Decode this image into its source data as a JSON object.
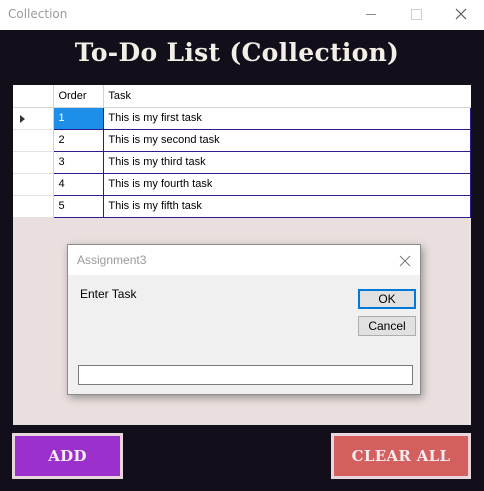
{
  "window": {
    "title": "Collection"
  },
  "app": {
    "heading": "To-Do List (Collection)"
  },
  "grid": {
    "columns": [
      "Order",
      "Task"
    ],
    "rows": [
      {
        "order": "1",
        "task": "This is my first task"
      },
      {
        "order": "2",
        "task": "This is my second task"
      },
      {
        "order": "3",
        "task": "This is my third task"
      },
      {
        "order": "4",
        "task": "This is my fourth task"
      },
      {
        "order": "5",
        "task": "This is my fifth task"
      }
    ],
    "selected_row": 0
  },
  "dialog": {
    "title": "Assignment3",
    "prompt": "Enter Task",
    "ok_label": "OK",
    "cancel_label": "Cancel",
    "input_value": ""
  },
  "buttons": {
    "add_label": "ADD",
    "clear_label": "CLEAR ALL"
  },
  "colors": {
    "app_background": "#120e1a",
    "panel_background": "#e9dfde",
    "selection": "#1e8fe8",
    "grid_border": "#2a1b8f",
    "add_button": "#9b30cc",
    "clear_button": "#d35f5f"
  },
  "icons": {
    "minimize": "minimize-icon",
    "maximize": "maximize-icon",
    "close": "close-icon",
    "row_indicator": "row-pointer-icon"
  }
}
